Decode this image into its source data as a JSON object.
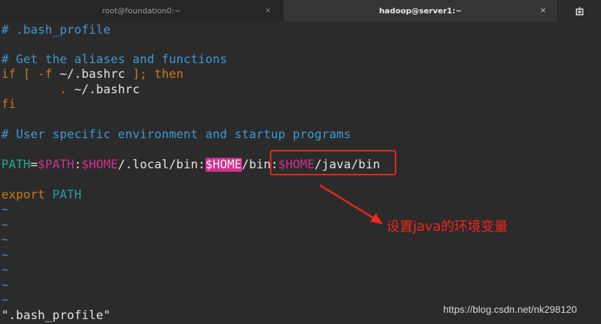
{
  "tabs": [
    {
      "title": "root@foundation0:~",
      "close": "×",
      "active": false
    },
    {
      "title": "hadoop@server1:~",
      "close": "×",
      "active": true
    }
  ],
  "new_tab_icon": "new-tab-icon",
  "editor": {
    "lines": {
      "l1": "# .bash_profile",
      "l3": "# Get the aliases and functions",
      "l4_if": "if [ -f ",
      "l4_path": "~/.bashrc",
      "l4_end": " ]; ",
      "l4_then": "then",
      "l5_dot": "        . ",
      "l5_path": "~/.bashrc",
      "l6": "fi",
      "l8": "# User specific environment and startup programs",
      "l10_path": "PATH",
      "l10_eq": "=",
      "l10_v1": "$PATH",
      "l10_c1": ":",
      "l10_v2": "$HOME",
      "l10_s1": "/.local/bin:",
      "l10_v3": "$HOME",
      "l10_s2": "/bin:",
      "l10_v4": "$HOME",
      "l10_s3": "/java/bin",
      "l12_export": "export",
      "l12_sp": " ",
      "l12_path": "PATH",
      "tilde": "~",
      "status": "\".bash_profile\""
    }
  },
  "annotation": {
    "text": "设置java的环境变量",
    "color": "#f0261a"
  },
  "watermark": "https://blog.csdn.net/nk298120",
  "colors": {
    "background": "#2b2b2b",
    "comment": "#3d9ad6",
    "keyword": "#cc7a14",
    "variable": "#d0318e",
    "identifier": "#2aa198"
  }
}
